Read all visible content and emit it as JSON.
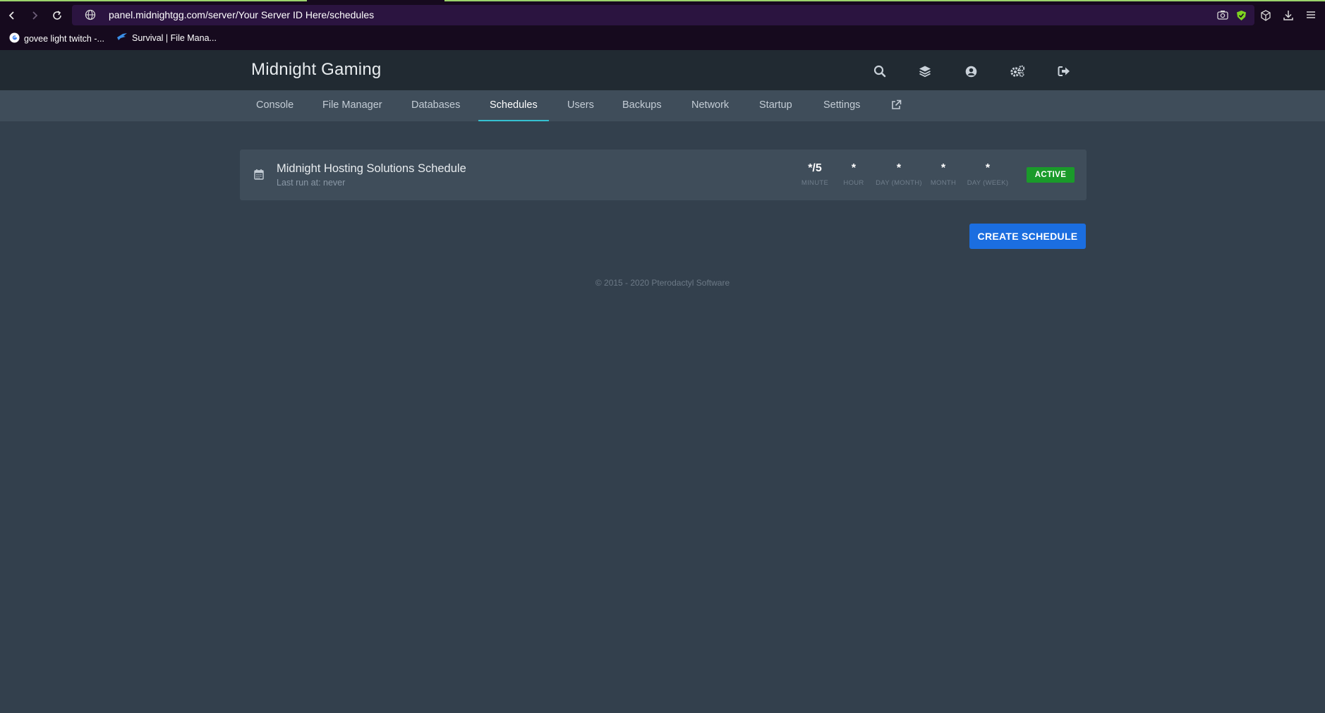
{
  "browser": {
    "url": "panel.midnightgg.com/server/Your Server ID Here/schedules",
    "bookmarks": [
      {
        "label": "govee light twitch -..."
      },
      {
        "label": "Survival | File Mana..."
      }
    ]
  },
  "header": {
    "brand": "Midnight Gaming"
  },
  "nav": {
    "items": [
      {
        "label": "Console"
      },
      {
        "label": "File Manager"
      },
      {
        "label": "Databases"
      },
      {
        "label": "Schedules"
      },
      {
        "label": "Users"
      },
      {
        "label": "Backups"
      },
      {
        "label": "Network"
      },
      {
        "label": "Startup"
      },
      {
        "label": "Settings"
      }
    ],
    "active": "Schedules"
  },
  "schedule": {
    "name": "Midnight Hosting Solutions Schedule",
    "last_run": "Last run at: never",
    "cron": [
      {
        "value": "*/5",
        "label": "MINUTE"
      },
      {
        "value": "*",
        "label": "HOUR"
      },
      {
        "value": "*",
        "label": "DAY (MONTH)"
      },
      {
        "value": "*",
        "label": "MONTH"
      },
      {
        "value": "*",
        "label": "DAY (WEEK)"
      }
    ],
    "status": "ACTIVE"
  },
  "actions": {
    "create_label": "CREATE SCHEDULE"
  },
  "footer": {
    "copyright": "© 2015 - 2020 Pterodactyl Software"
  },
  "colors": {
    "page_bg": "#33404d",
    "header_bg": "#212a32",
    "subnav_bg": "#3f4d5a",
    "active_tab_underline": "#35c1d1",
    "active_badge": "#1a9a2a",
    "primary_button": "#1b6ee0"
  }
}
